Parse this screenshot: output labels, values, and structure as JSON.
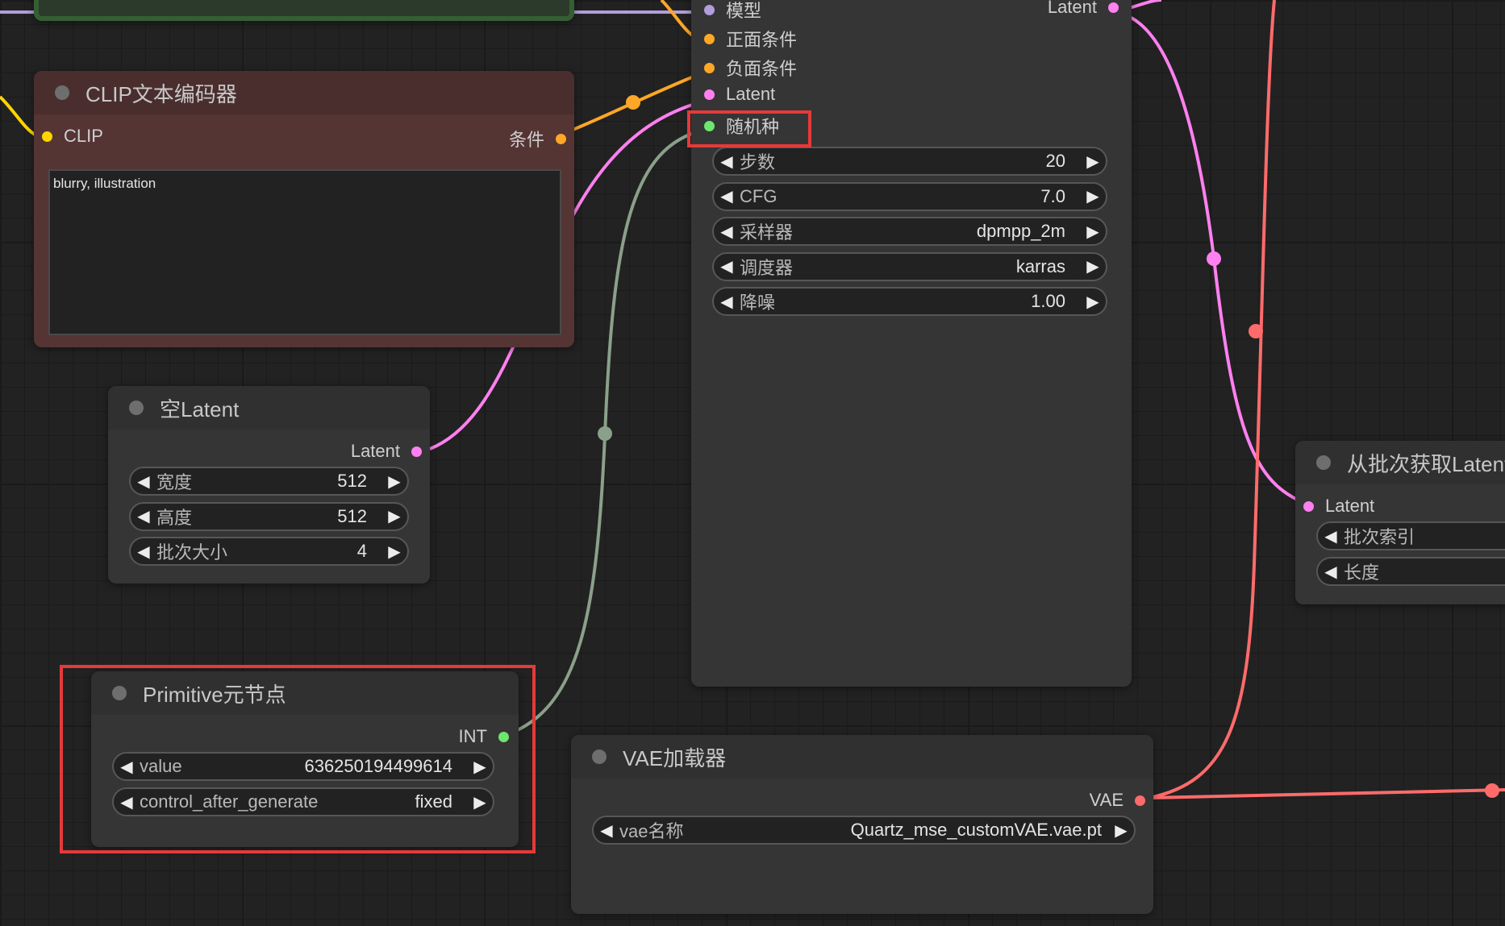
{
  "ksampler": {
    "inputs": [
      {
        "label": "模型",
        "color": "#b39ddb"
      },
      {
        "label": "正面条件",
        "color": "#ffa726"
      },
      {
        "label": "负面条件",
        "color": "#ffa726"
      },
      {
        "label": "Latent",
        "color": "#ff80f0"
      },
      {
        "label": "随机种",
        "color": "#6ee66e"
      }
    ],
    "output_label": "Latent",
    "widgets": [
      {
        "label": "步数",
        "value": "20"
      },
      {
        "label": "CFG",
        "value": "7.0"
      },
      {
        "label": "采样器",
        "value": "dpmpp_2m"
      },
      {
        "label": "调度器",
        "value": "karras"
      },
      {
        "label": "降噪",
        "value": "1.00"
      }
    ]
  },
  "clip_node": {
    "title": "CLIP文本编码器",
    "input_label": "CLIP",
    "output_label": "条件",
    "text": "blurry, illustration"
  },
  "empty_latent": {
    "title": "空Latent",
    "output_label": "Latent",
    "widgets": [
      {
        "label": "宽度",
        "value": "512"
      },
      {
        "label": "高度",
        "value": "512"
      },
      {
        "label": "批次大小",
        "value": "4"
      }
    ]
  },
  "primitive": {
    "title": "Primitive元节点",
    "output_label": "INT",
    "widgets": [
      {
        "label": "value",
        "value": "636250194499614"
      },
      {
        "label": "control_after_generate",
        "value": "fixed"
      }
    ]
  },
  "vae_loader": {
    "title": "VAE加载器",
    "output_label": "VAE",
    "widget": {
      "label": "vae名称",
      "value": "Quartz_mse_customVAE.vae.pt"
    }
  },
  "latent_from_batch": {
    "title": "从批次获取Latent",
    "input_label": "Latent",
    "widgets": [
      {
        "label": "批次索引"
      },
      {
        "label": "长度"
      }
    ]
  },
  "colors": {
    "model": "#b39ddb",
    "conditioning": "#ffa726",
    "latent": "#ff80f0",
    "int": "#6ee66e",
    "vae": "#ff6b6b",
    "clip": "#ffd500",
    "highlight": "#e53a3a"
  }
}
